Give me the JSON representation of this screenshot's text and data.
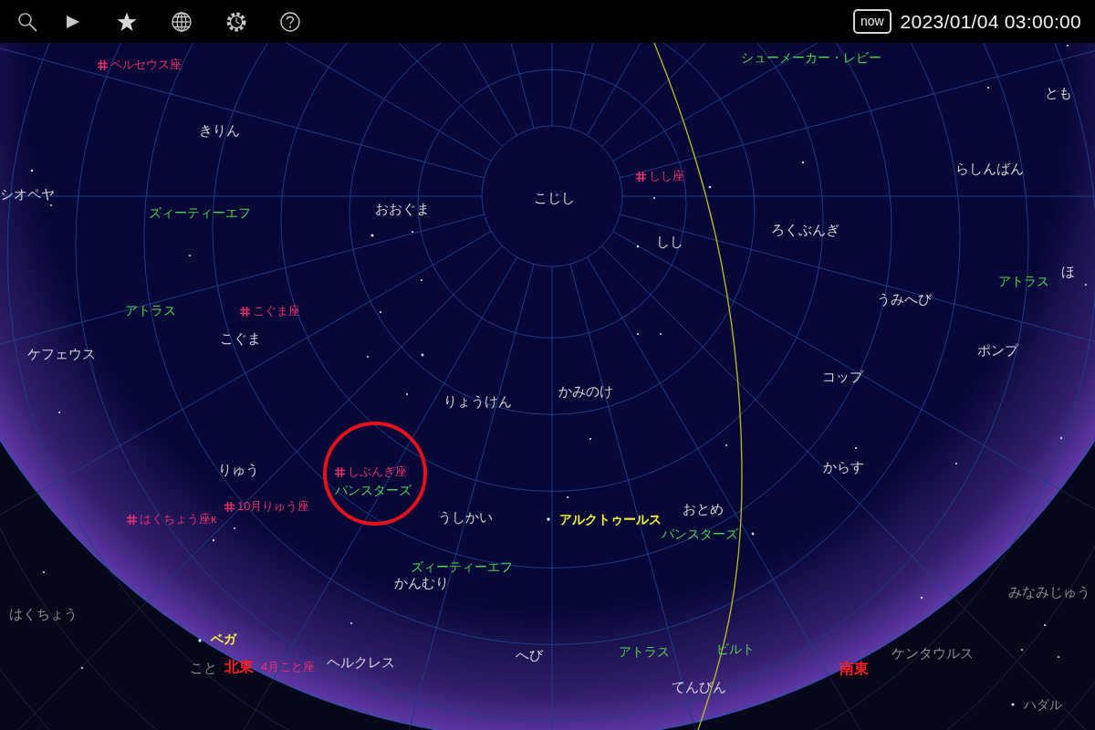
{
  "toolbar": {
    "now_button": "now",
    "datetime": "2023/01/04 03:00:00"
  },
  "sky_chart": {
    "constellations": [
      {
        "name": "きりん",
        "below_horizon": false
      },
      {
        "name": "こじし",
        "below_horizon": false
      },
      {
        "name": "シオペヤ",
        "below_horizon": false
      },
      {
        "name": "とも",
        "below_horizon": false
      },
      {
        "name": "らしんばん",
        "below_horizon": false
      },
      {
        "name": "おおぐま",
        "below_horizon": false
      },
      {
        "name": "しし",
        "below_horizon": false
      },
      {
        "name": "ろくぶんぎ",
        "below_horizon": false
      },
      {
        "name": "ほ",
        "below_horizon": false
      },
      {
        "name": "うみへび",
        "below_horizon": false
      },
      {
        "name": "こぐま",
        "below_horizon": false
      },
      {
        "name": "ケフェウス",
        "below_horizon": false
      },
      {
        "name": "ポンプ",
        "below_horizon": false
      },
      {
        "name": "コップ",
        "below_horizon": false
      },
      {
        "name": "かみのけ",
        "below_horizon": false
      },
      {
        "name": "りょうけん",
        "below_horizon": false
      },
      {
        "name": "からす",
        "below_horizon": false
      },
      {
        "name": "りゅう",
        "below_horizon": false
      },
      {
        "name": "おとめ",
        "below_horizon": false
      },
      {
        "name": "うしかい",
        "below_horizon": false
      },
      {
        "name": "かんむり",
        "below_horizon": false
      },
      {
        "name": "みなみじゅう",
        "below_horizon": true
      },
      {
        "name": "はくちょう",
        "below_horizon": true
      },
      {
        "name": "ケンタウルス",
        "below_horizon": true
      },
      {
        "name": "ヘルクレス",
        "below_horizon": false
      },
      {
        "name": "へび",
        "below_horizon": false
      },
      {
        "name": "こと",
        "below_horizon": true
      },
      {
        "name": "てんびん",
        "below_horizon": false
      }
    ],
    "stars": [
      {
        "name": "アルクトゥールス",
        "below_horizon": false
      },
      {
        "name": "ベガ",
        "below_horizon": false
      },
      {
        "name": "ハダル",
        "below_horizon": true
      }
    ],
    "comets": [
      {
        "name": "シューメーカー・レビー"
      },
      {
        "name": "ズィーティーエフ"
      },
      {
        "name": "アトラス"
      },
      {
        "name": "アトラス"
      },
      {
        "name": "パンスターズ"
      },
      {
        "name": "パンスターズ"
      },
      {
        "name": "ズィーティーエフ"
      },
      {
        "name": "アトラス"
      },
      {
        "name": "ビルト"
      }
    ],
    "meteor_showers": [
      {
        "name": "ペルセウス座",
        "radiant_marker": true,
        "circled": false
      },
      {
        "name": "しし座",
        "radiant_marker": true,
        "circled": false
      },
      {
        "name": "こぐま座",
        "radiant_marker": true,
        "circled": false
      },
      {
        "name": "しぶんぎ座",
        "radiant_marker": true,
        "circled": true
      },
      {
        "name": "10月りゅう座",
        "radiant_marker": true,
        "circled": false
      },
      {
        "name": "はくちょう座κ",
        "radiant_marker": true,
        "circled": false
      },
      {
        "name": "4月こと座",
        "radiant_marker": false,
        "circled": false
      }
    ],
    "directions": [
      {
        "name": "北東"
      },
      {
        "name": "南東"
      }
    ]
  }
}
